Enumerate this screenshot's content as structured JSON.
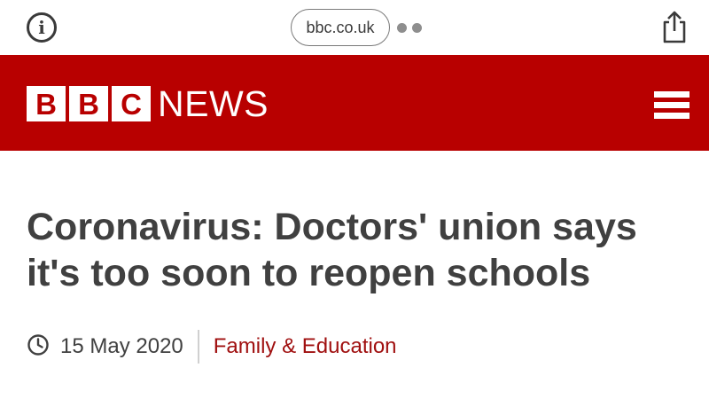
{
  "browser": {
    "url": "bbc.co.uk"
  },
  "header": {
    "logo_letters": [
      "B",
      "B",
      "C"
    ],
    "section": "NEWS",
    "brand_color": "#b80000"
  },
  "article": {
    "headline": "Coronavirus: Doctors' union says it's too soon to reopen schools",
    "date": "15 May 2020",
    "category": "Family & Education"
  },
  "icons": {
    "info": "info-icon",
    "share": "share-icon",
    "menu": "hamburger-menu-icon",
    "clock": "clock-icon"
  }
}
